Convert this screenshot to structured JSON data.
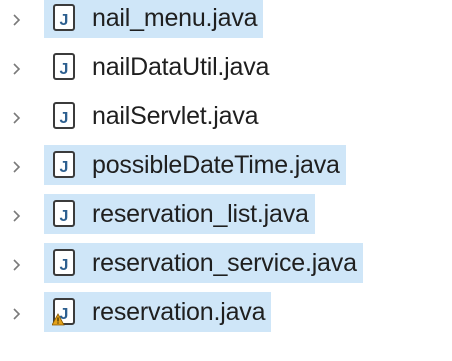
{
  "file_tree": {
    "items": [
      {
        "label": "nail_menu.java",
        "selected": true,
        "icon": "java-file-icon"
      },
      {
        "label": "nailDataUtil.java",
        "selected": false,
        "icon": "java-file-icon"
      },
      {
        "label": "nailServlet.java",
        "selected": false,
        "icon": "java-file-icon"
      },
      {
        "label": "possibleDateTime.java",
        "selected": true,
        "icon": "java-file-icon"
      },
      {
        "label": "reservation_list.java",
        "selected": true,
        "icon": "java-file-icon"
      },
      {
        "label": "reservation_service.java",
        "selected": true,
        "icon": "java-file-icon"
      },
      {
        "label": "reservation.java",
        "selected": true,
        "icon": "java-file-warning-icon"
      }
    ],
    "chevron_icon": "chevron-right-icon",
    "selection_color": "#cfe6f8",
    "warning_color": "#e3a21a"
  }
}
